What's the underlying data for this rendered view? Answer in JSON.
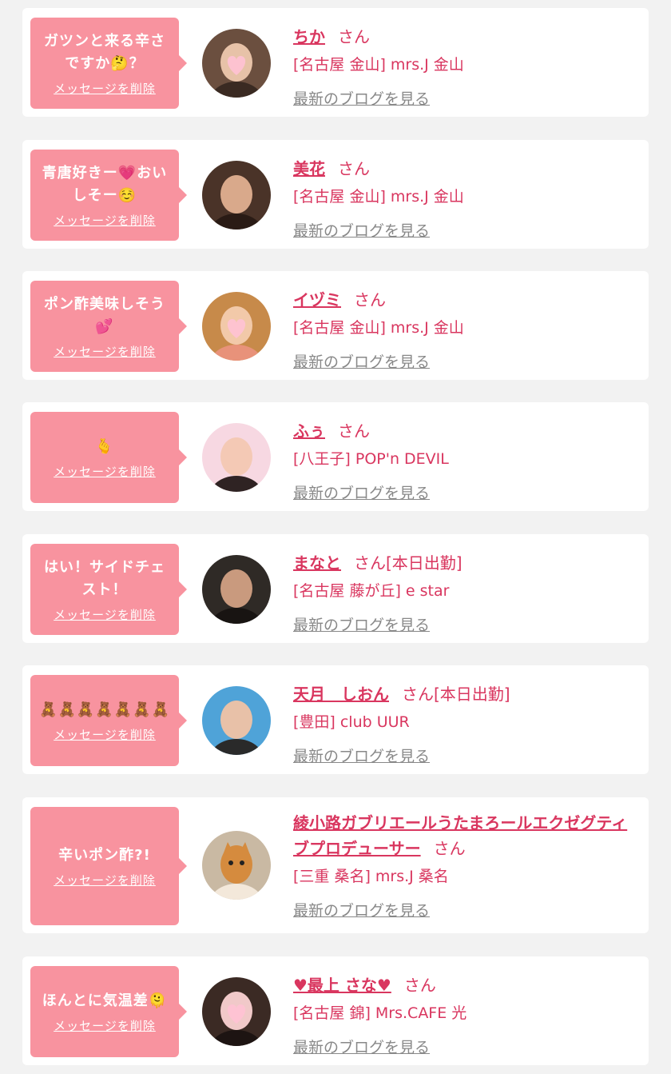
{
  "common": {
    "delete_label": "メッセージを削除",
    "san_label": "さん",
    "blog_label": "最新のブログを見る"
  },
  "colors": {
    "bubble": "#f8939f",
    "name": "#d9365f",
    "link_gray": "#888888",
    "background": "#f2f2f2"
  },
  "entries": [
    {
      "message": "ガツンと来る辛さですか🤔？",
      "name": "ちか",
      "suffix": "",
      "shop": "[名古屋 金山] mrs.J 金山",
      "avatar_icon": "avatar-heart-sticker-photo"
    },
    {
      "message": "青唐好きー💗おいしそー☺️",
      "name": "美花",
      "suffix": "",
      "shop": "[名古屋 金山] mrs.J 金山",
      "avatar_icon": "avatar-photo"
    },
    {
      "message": "ポン酢美味しそう💕",
      "name": "イヅミ",
      "suffix": "",
      "shop": "[名古屋 金山] mrs.J 金山",
      "avatar_icon": "avatar-heart-sticker-photo"
    },
    {
      "message": "🫰",
      "name": "ふぅ",
      "suffix": "",
      "shop": "[八王子] POP'n DEVIL",
      "avatar_icon": "avatar-photo"
    },
    {
      "message": "はい！サイドチェスト！",
      "name": "まなと",
      "suffix": "[本日出勤]",
      "shop": "[名古屋 藤が丘] e star",
      "avatar_icon": "avatar-photo"
    },
    {
      "message": "🧸🧸🧸🧸🧸🧸🧸",
      "name": "天月　しおん",
      "suffix": "[本日出勤]",
      "shop": "[豊田] club UUR",
      "avatar_icon": "avatar-photo"
    },
    {
      "message": "辛いポン酢?!",
      "name": "綾小路ガブリエールうたまろールエクゼグティブプロデューサー",
      "suffix": "",
      "shop": "[三重 桑名] mrs.J 桑名",
      "avatar_icon": "avatar-cat-photo"
    },
    {
      "message": "ほんとに気温差🫠",
      "name": "♥最上 さな♥",
      "suffix": "",
      "shop": "[名古屋 錦] Mrs.CAFE 光",
      "avatar_icon": "avatar-heart-sticker-photo"
    }
  ]
}
